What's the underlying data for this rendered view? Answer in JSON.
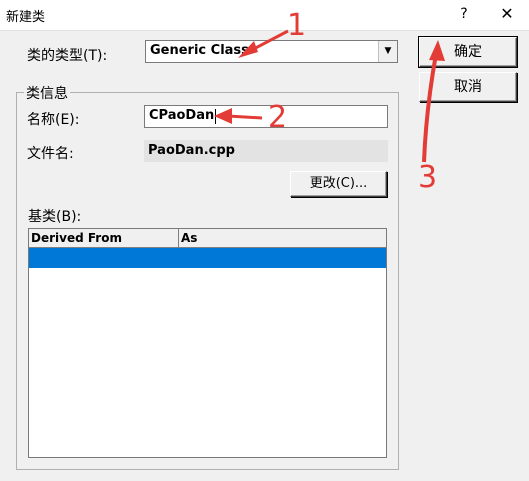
{
  "window": {
    "title": "新建类",
    "help_label": "?",
    "close_label": "✕"
  },
  "class_type": {
    "label": "类的类型(T):",
    "value": "Generic Class"
  },
  "buttons": {
    "ok_label": "确定",
    "cancel_label": "取消",
    "change_label": "更改(C)..."
  },
  "class_info": {
    "group_label": "类信息",
    "name_label": "名称(E):",
    "name_value": "CPaoDan",
    "filename_label": "文件名:",
    "filename_value": "PaoDan.cpp"
  },
  "base_class": {
    "label": "基类(B):",
    "columns": [
      "Derived From",
      "As"
    ],
    "rows": [
      {
        "derived_from": "",
        "as": "",
        "selected": true
      }
    ]
  },
  "annotations": {
    "color": "#e33b36",
    "labels": [
      "1",
      "2",
      "3"
    ]
  },
  "colors": {
    "selection": "#0078d7",
    "dialog_bg": "#f0f0f0"
  }
}
